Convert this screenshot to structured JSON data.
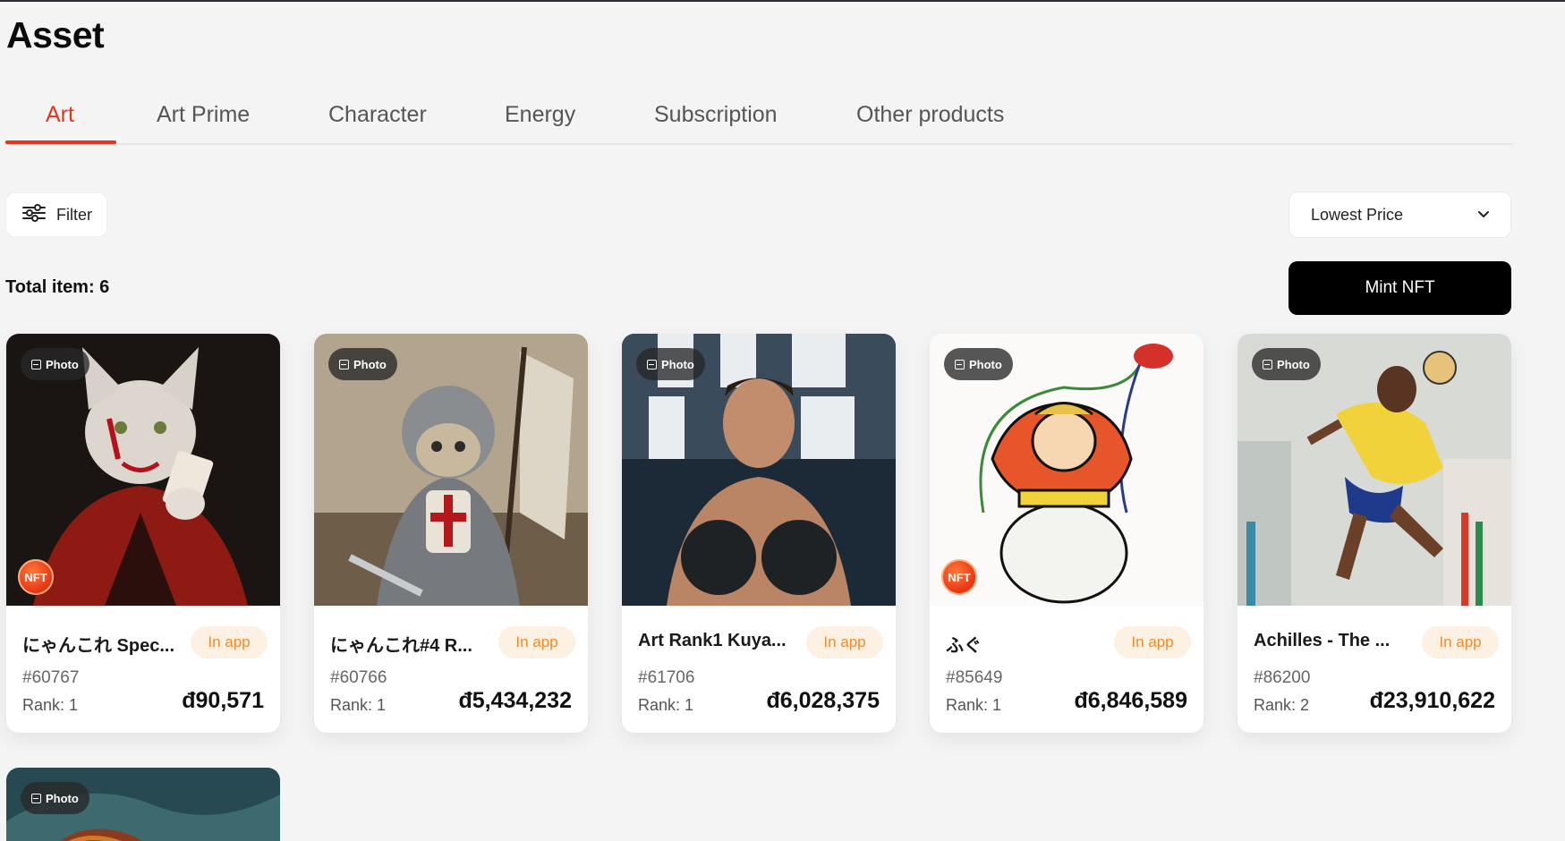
{
  "page": {
    "title": "Asset"
  },
  "tabs": [
    {
      "label": "Art",
      "active": true
    },
    {
      "label": "Art Prime"
    },
    {
      "label": "Character"
    },
    {
      "label": "Energy"
    },
    {
      "label": "Subscription"
    },
    {
      "label": "Other products"
    }
  ],
  "toolbar": {
    "filter_label": "Filter",
    "sort_label": "Lowest Price",
    "total_label": "Total item: 6",
    "mint_label": "Mint NFT"
  },
  "colors": {
    "accent": "#e5351f",
    "inapp_bg": "#fdf1e3",
    "inapp_text": "#f08a2a",
    "mint_bg": "#000000"
  },
  "cards": [
    {
      "badge": "Photo",
      "nft_badge": "NFT",
      "name": "にゃんこれ Spec...",
      "status": "In app",
      "token_id": "#60767",
      "rank": "Rank: 1",
      "price": "đ90,571"
    },
    {
      "badge": "Photo",
      "nft_badge": "",
      "name": "にゃんこれ#4 R...",
      "status": "In app",
      "token_id": "#60766",
      "rank": "Rank: 1",
      "price": "đ5,434,232"
    },
    {
      "badge": "Photo",
      "nft_badge": "",
      "name": "Art Rank1 Kuya...",
      "status": "In app",
      "token_id": "#61706",
      "rank": "Rank: 1",
      "price": "đ6,028,375"
    },
    {
      "badge": "Photo",
      "nft_badge": "NFT",
      "name": "ふぐ",
      "status": "In app",
      "token_id": "#85649",
      "rank": "Rank: 1",
      "price": "đ6,846,589"
    },
    {
      "badge": "Photo",
      "nft_badge": "",
      "name": "Achilles - The ...",
      "status": "In app",
      "token_id": "#86200",
      "rank": "Rank: 2",
      "price": "đ23,910,622"
    },
    {
      "badge": "Photo"
    }
  ]
}
